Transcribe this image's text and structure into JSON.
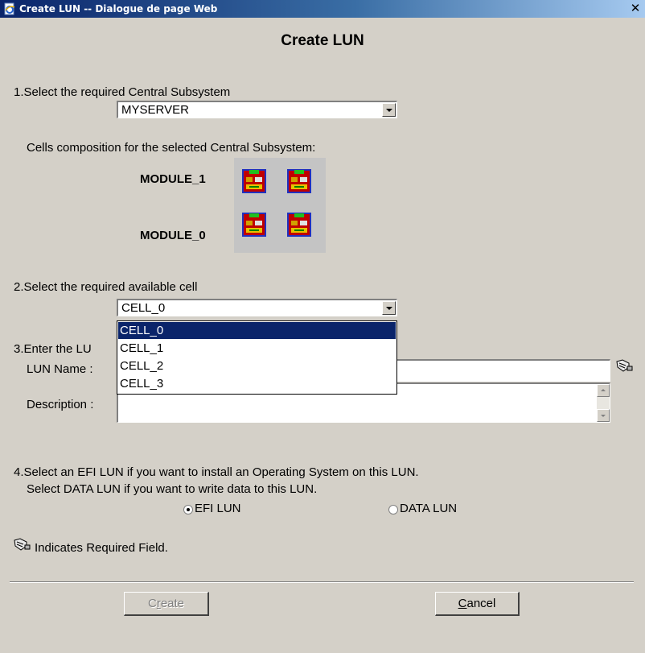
{
  "window": {
    "title": "Create LUN -- Dialogue de page Web",
    "close_glyph": "✕"
  },
  "heading": "Create LUN",
  "step1": {
    "label": "1.Select the required Central Subsystem",
    "selected": "MYSERVER",
    "cells_caption": "Cells composition for the selected Central Subsystem:",
    "modules": [
      {
        "label": "MODULE_1",
        "cells": 2
      },
      {
        "label": "MODULE_0",
        "cells": 2
      }
    ]
  },
  "step2": {
    "label": "2.Select the required available cell",
    "selected": "CELL_0",
    "options": [
      "CELL_0",
      "CELL_1",
      "CELL_2",
      "CELL_3"
    ]
  },
  "step3": {
    "label_visible": "3.Enter the LU",
    "name_label": "LUN Name :",
    "name_value": "",
    "description_label": "Description :",
    "description_value": ""
  },
  "step4": {
    "line1": "4.Select an EFI LUN if you want to install an Operating System on this LUN.",
    "line2": "Select DATA LUN if you want to write data to this LUN.",
    "options": [
      {
        "label": "EFI LUN",
        "checked": true
      },
      {
        "label": "DATA LUN",
        "checked": false
      }
    ]
  },
  "legend": {
    "icon": "required-field-icon",
    "text": "Indicates Required Field."
  },
  "buttons": {
    "create": {
      "first": "C",
      "mnemonic": "r",
      "rest": "eate",
      "enabled": false
    },
    "cancel": {
      "mnemonic": "C",
      "rest": "ancel",
      "enabled": true
    }
  },
  "colors": {
    "dialog_bg": "#d4d0c8",
    "titlebar": "#0a246a",
    "selection": "#0a246a"
  }
}
